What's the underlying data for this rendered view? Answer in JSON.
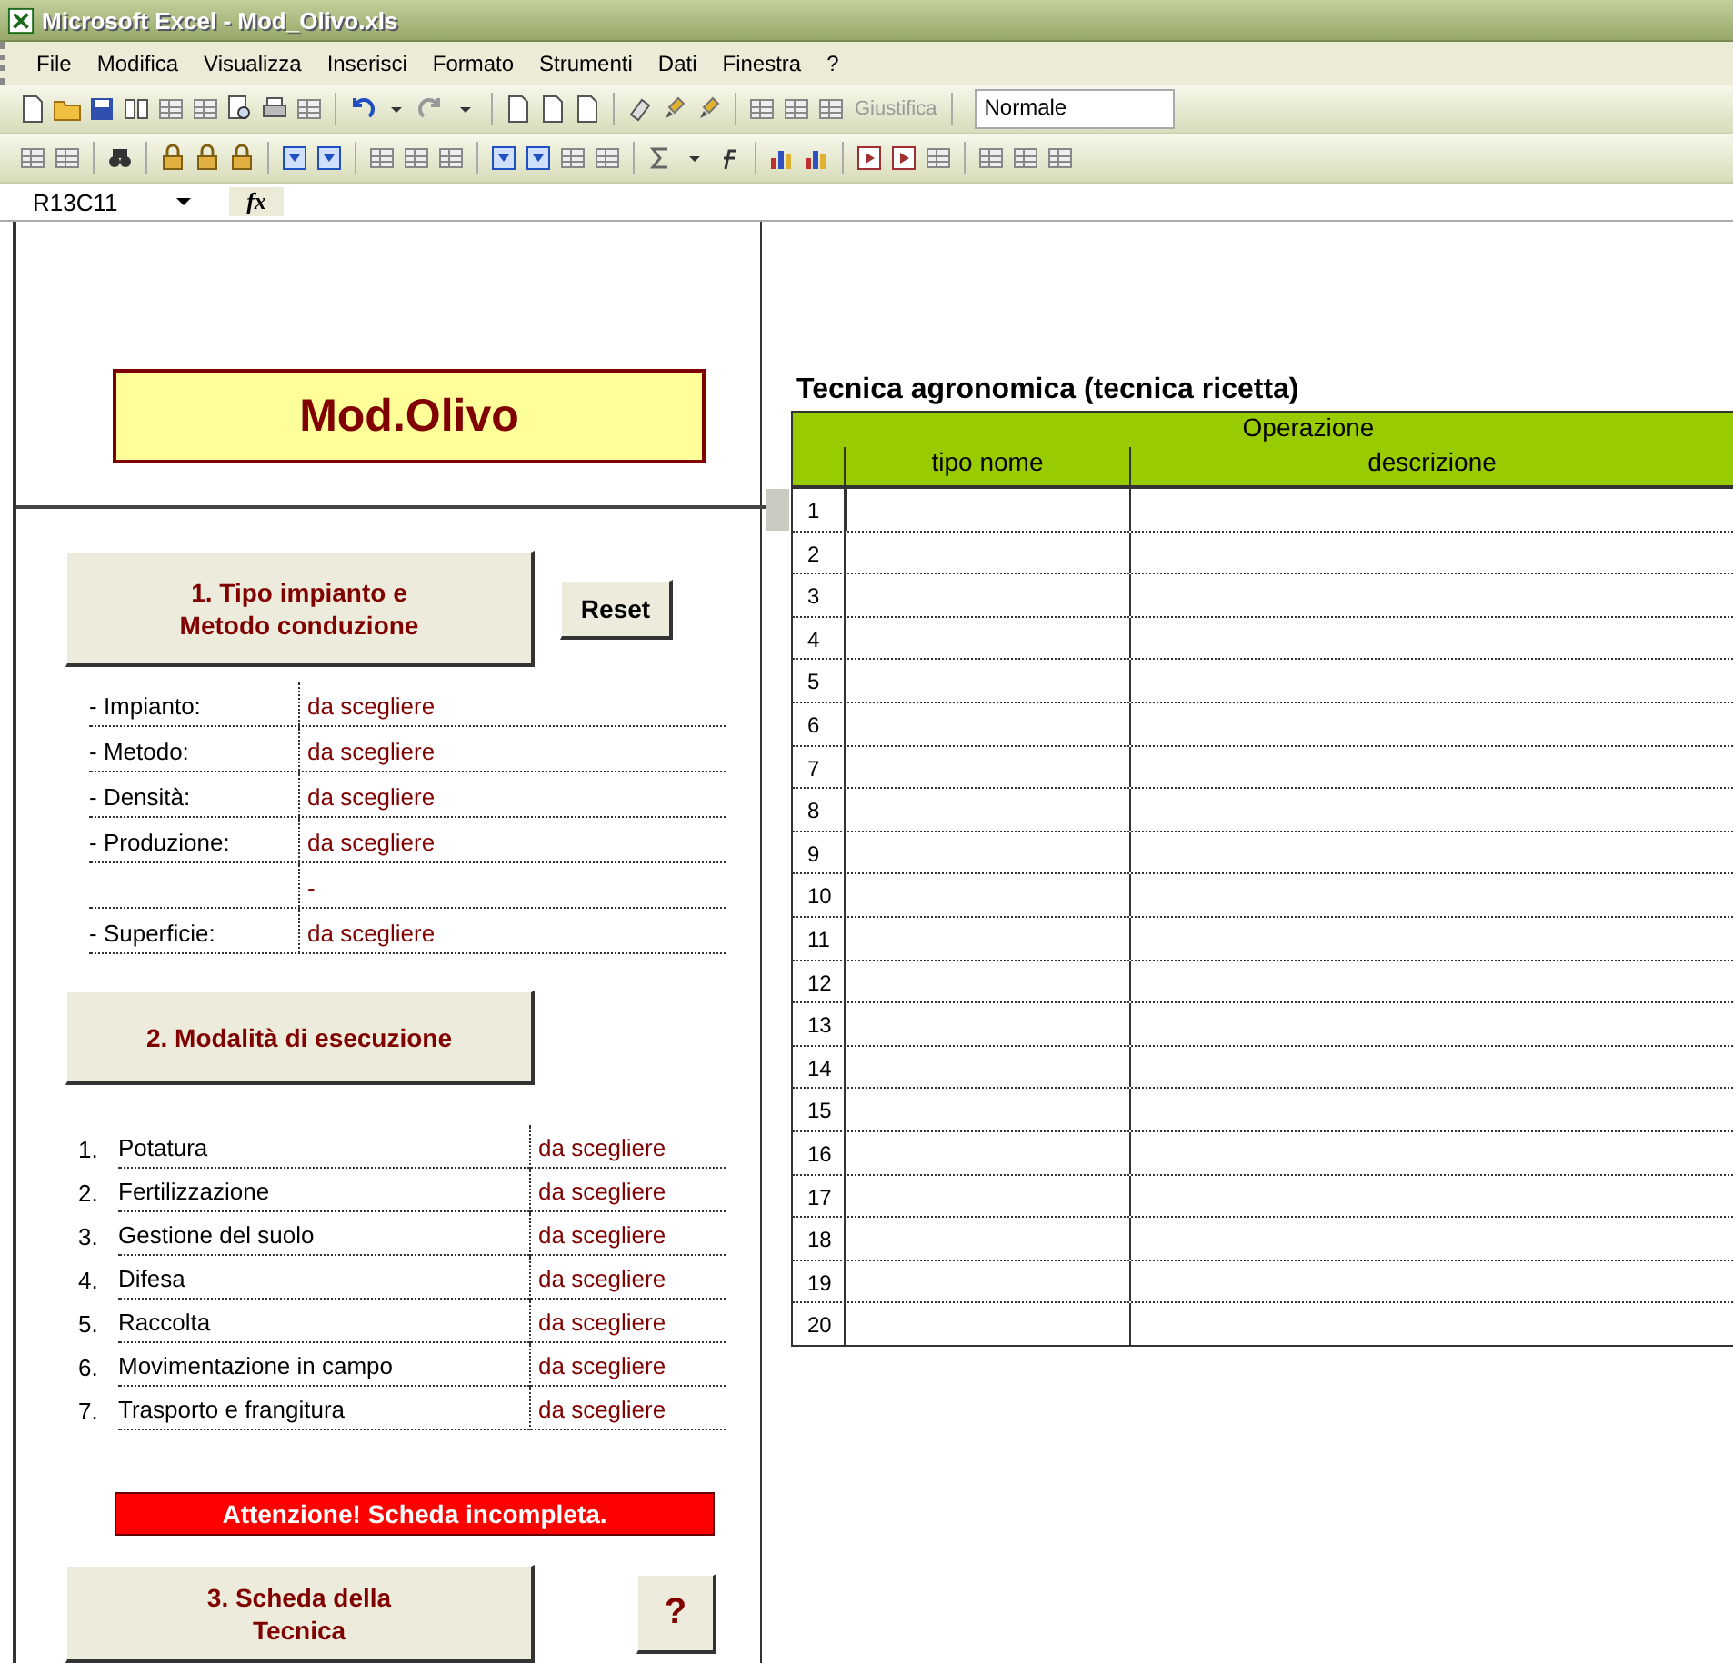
{
  "window": {
    "title": "Microsoft Excel - Mod_Olivo.xls"
  },
  "menu": [
    "File",
    "Modifica",
    "Visualizza",
    "Inserisci",
    "Formato",
    "Strumenti",
    "Dati",
    "Finestra",
    "?"
  ],
  "toolbar": {
    "justify_button": {
      "label": "Giustifica",
      "disabled": true
    },
    "style_box": {
      "value": "Normale"
    }
  },
  "formula_bar": {
    "name_box": "R13C11",
    "function_symbol": "fx"
  },
  "sheet": {
    "logo": "Mod.Olivo",
    "section1": {
      "button": "1. Tipo impianto e Metodo conduzione",
      "reset": "Reset",
      "rows": [
        {
          "label": "- Impianto:",
          "value": "da scegliere"
        },
        {
          "label": "- Metodo:",
          "value": "da scegliere"
        },
        {
          "label": "- Densità:",
          "value": "da scegliere"
        },
        {
          "label": "- Produzione:",
          "value": "da scegliere"
        },
        {
          "value": "-"
        },
        {
          "label": "- Superficie:",
          "value": "da scegliere"
        }
      ]
    },
    "section2": {
      "button": "2. Modalità di esecuzione",
      "rows": [
        {
          "number": "1.",
          "label": "Potatura",
          "value": "da scegliere"
        },
        {
          "number": "2.",
          "label": "Fertilizzazione",
          "value": "da scegliere"
        },
        {
          "number": "3.",
          "label": "Gestione del suolo",
          "value": "da scegliere"
        },
        {
          "number": "4.",
          "label": "Difesa",
          "value": "da scegliere"
        },
        {
          "number": "5.",
          "label": "Raccolta",
          "value": "da scegliere"
        },
        {
          "number": "6.",
          "label": "Movimentazione in campo",
          "value": "da scegliere"
        },
        {
          "number": "7.",
          "label": "Trasporto e frangitura",
          "value": "da scegliere"
        }
      ]
    },
    "warning": "Attenzione! Scheda incompleta.",
    "section3": {
      "button": "3. Scheda della Tecnica",
      "help": "?"
    },
    "table": {
      "title": "Tecnica agronomica (tecnica ricetta)",
      "group_header": "Operazione",
      "columns": [
        "tipo nome",
        "descrizione"
      ],
      "rows": [
        {
          "number": "1",
          "selected": true
        },
        {
          "number": "2",
          "selected": false
        },
        {
          "number": "3",
          "selected": false
        },
        {
          "number": "4",
          "selected": false
        },
        {
          "number": "5",
          "selected": false
        },
        {
          "number": "6",
          "selected": false
        },
        {
          "number": "7",
          "selected": false
        },
        {
          "number": "8",
          "selected": false
        },
        {
          "number": "9",
          "selected": false
        },
        {
          "number": "10",
          "selected": false
        },
        {
          "number": "11",
          "selected": false
        },
        {
          "number": "12",
          "selected": false
        },
        {
          "number": "13",
          "selected": false
        },
        {
          "number": "14",
          "selected": false
        },
        {
          "number": "15",
          "selected": false
        },
        {
          "number": "16",
          "selected": false
        },
        {
          "number": "17",
          "selected": false
        },
        {
          "number": "18",
          "selected": false
        },
        {
          "number": "19",
          "selected": false
        },
        {
          "number": "20",
          "selected": false
        }
      ]
    }
  }
}
